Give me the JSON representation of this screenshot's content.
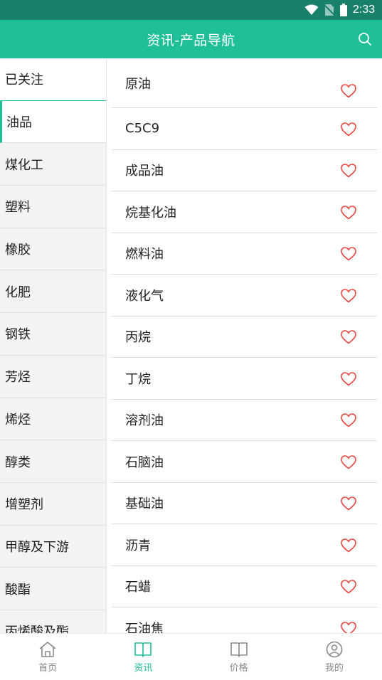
{
  "status_bar": {
    "time": "2:33",
    "icons": [
      "wifi-icon",
      "no-sim-icon",
      "battery-icon"
    ]
  },
  "app_bar": {
    "title": "资讯-产品导航",
    "search_icon": "search-icon"
  },
  "sidebar": {
    "items": [
      {
        "label": "已关注"
      },
      {
        "label": "油品"
      },
      {
        "label": "煤化工"
      },
      {
        "label": "塑料"
      },
      {
        "label": "橡胶"
      },
      {
        "label": "化肥"
      },
      {
        "label": "钢铁"
      },
      {
        "label": "芳烃"
      },
      {
        "label": "烯烃"
      },
      {
        "label": "醇类"
      },
      {
        "label": "增塑剂"
      },
      {
        "label": "甲醇及下游"
      },
      {
        "label": "酸酯"
      },
      {
        "label": "丙烯酸及酯"
      }
    ],
    "selected": "油品"
  },
  "products": {
    "items": [
      {
        "label": "原油"
      },
      {
        "label": "C5C9"
      },
      {
        "label": "成品油"
      },
      {
        "label": "烷基化油"
      },
      {
        "label": "燃料油"
      },
      {
        "label": "液化气"
      },
      {
        "label": "丙烷"
      },
      {
        "label": "丁烷"
      },
      {
        "label": "溶剂油"
      },
      {
        "label": "石脑油"
      },
      {
        "label": "基础油"
      },
      {
        "label": "沥青"
      },
      {
        "label": "石蜡"
      },
      {
        "label": "石油焦"
      }
    ],
    "favorite_icon": "heart-outline-icon",
    "favorite_color": "#e8463f"
  },
  "bottom_nav": {
    "items": [
      {
        "label": "首页",
        "icon": "home-icon"
      },
      {
        "label": "资讯",
        "icon": "book-icon"
      },
      {
        "label": "价格",
        "icon": "book-icon"
      },
      {
        "label": "我的",
        "icon": "user-icon"
      }
    ],
    "active": "资讯"
  },
  "colors": {
    "primary": "#1fbf98",
    "status_bar": "#19806a",
    "heart": "#e8463f"
  }
}
